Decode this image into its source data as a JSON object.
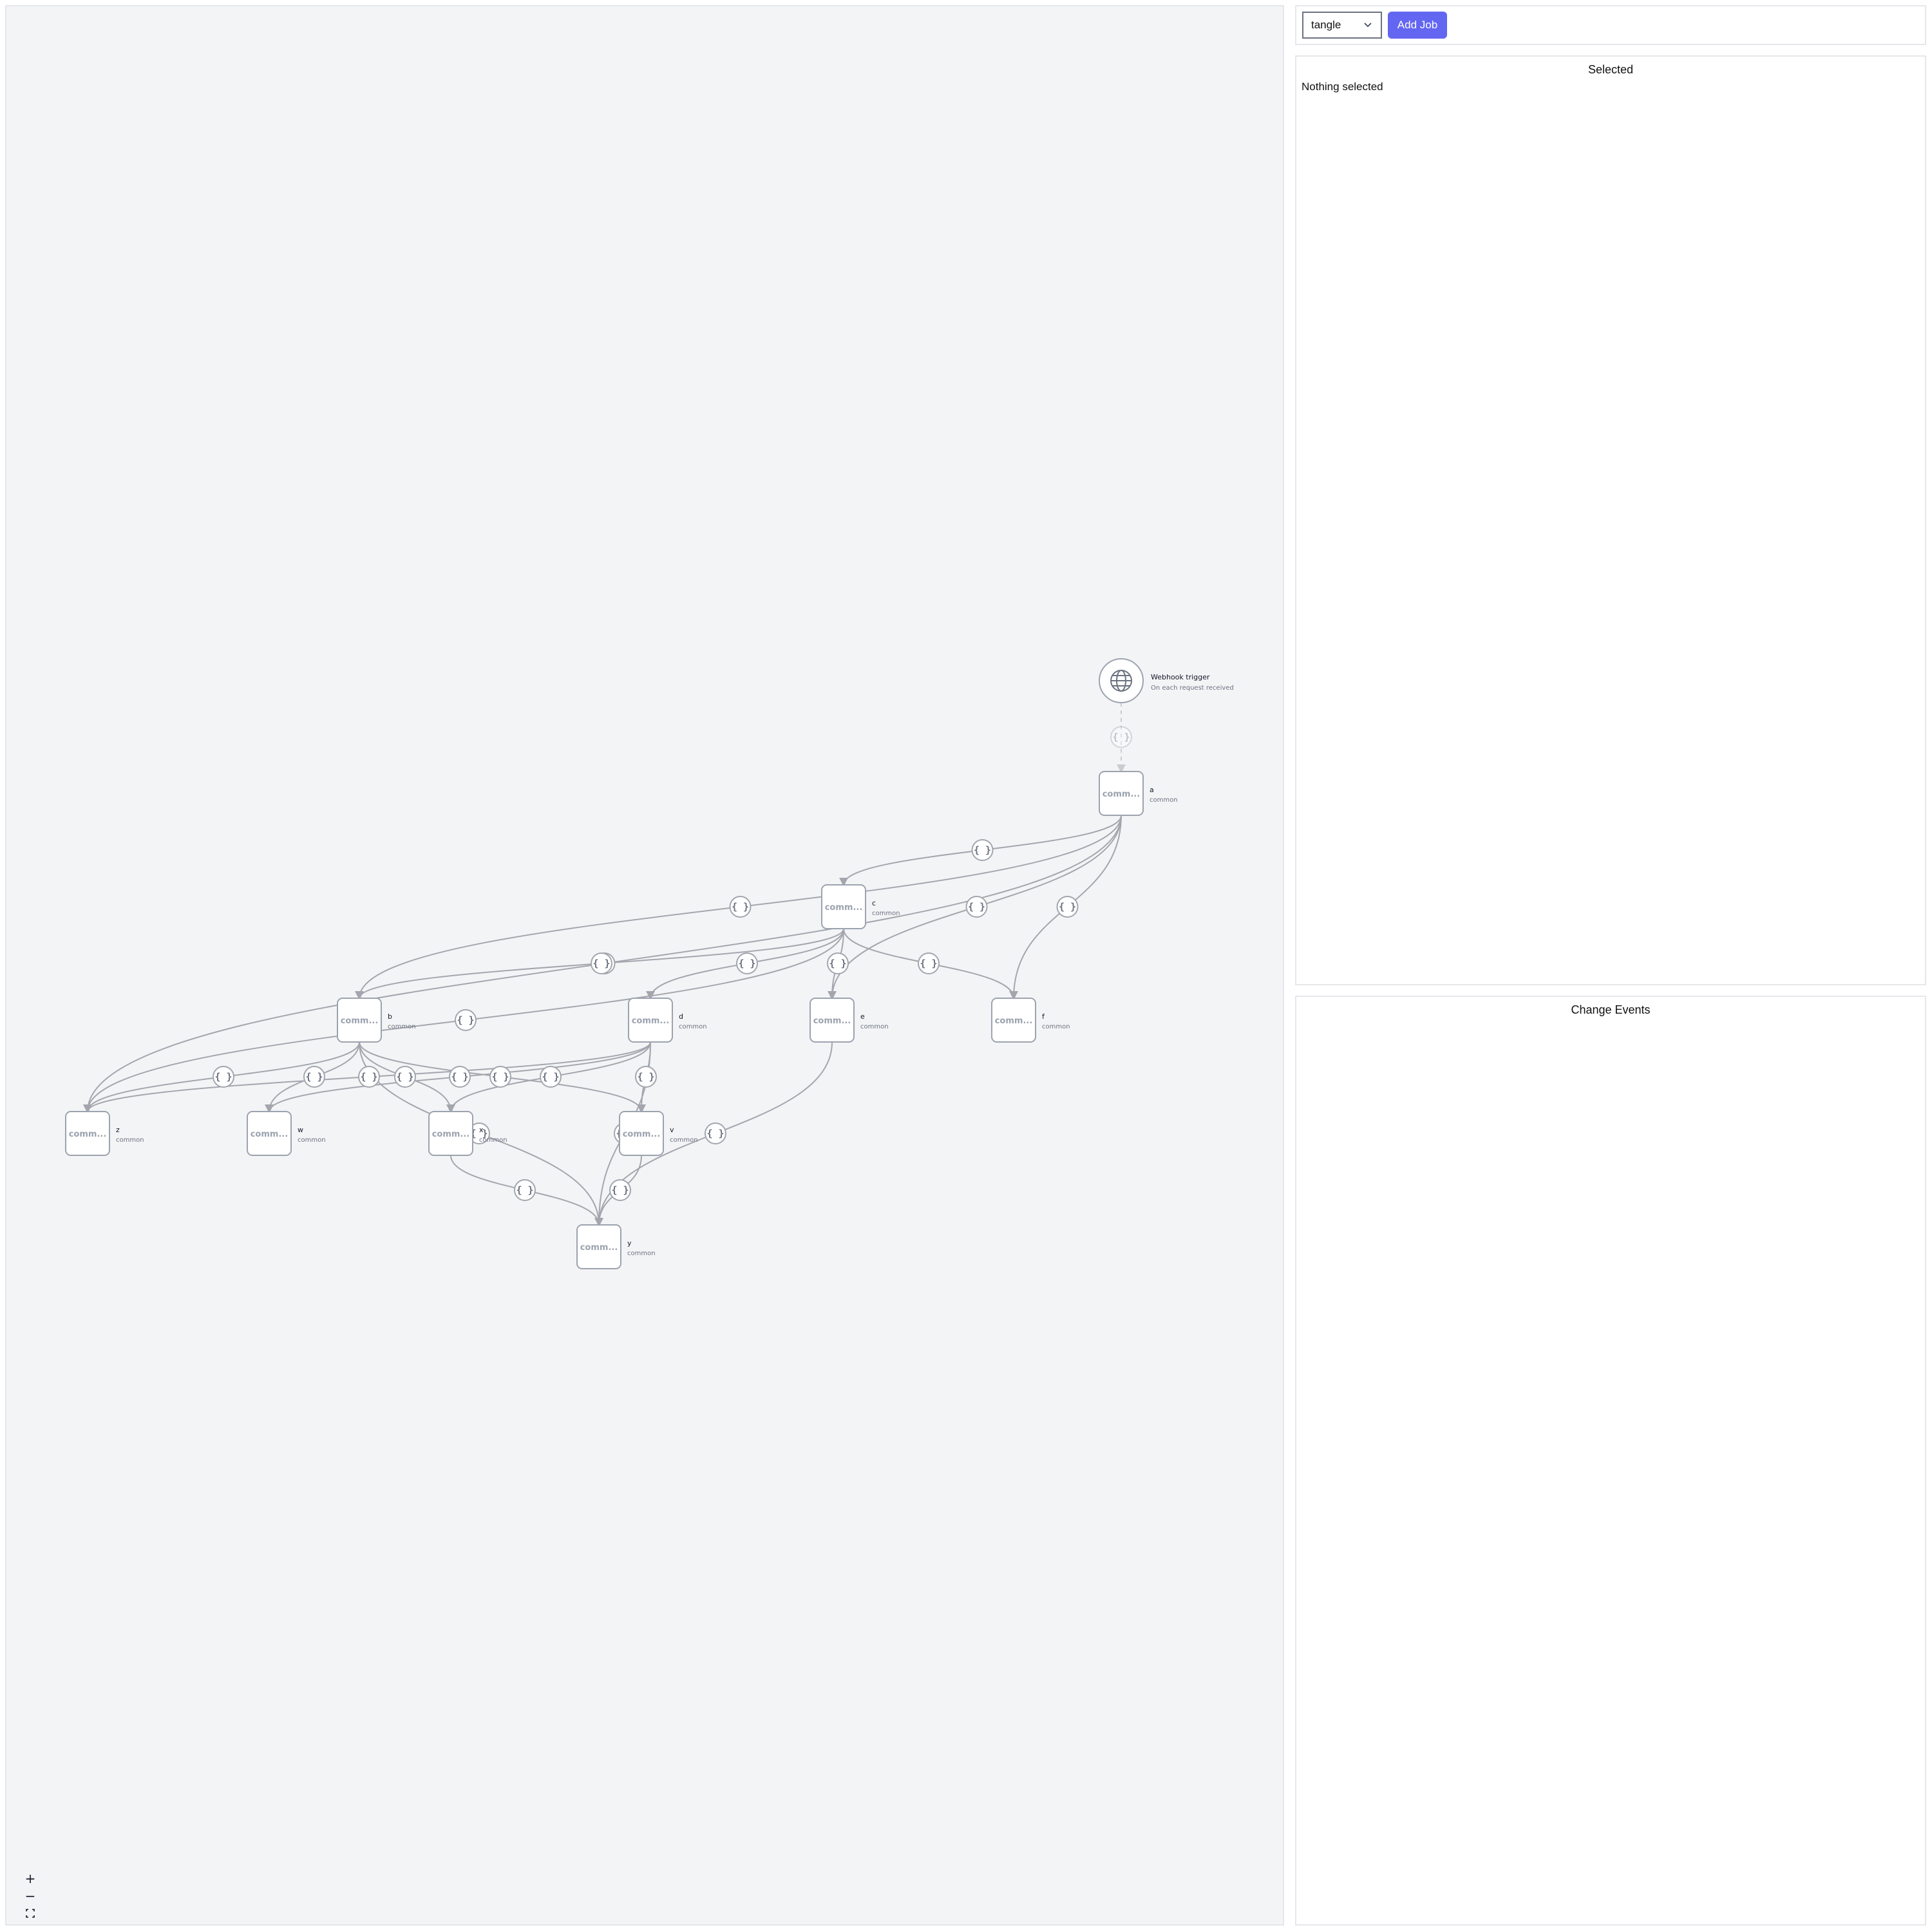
{
  "toolbar": {
    "workflow_select_value": "tangle",
    "add_job_label": "Add Job"
  },
  "selected_panel": {
    "title": "Selected",
    "empty_text": "Nothing selected"
  },
  "events_panel": {
    "title": "Change Events"
  },
  "zoom_controls": {
    "zoom_in": "+",
    "zoom_out": "−"
  },
  "graph": {
    "trigger": {
      "name": "Webhook trigger",
      "subtitle": "On each request received",
      "icon": "globe-icon"
    },
    "jobs": [
      {
        "id": "a",
        "name": "a",
        "subtitle": "common",
        "inner": "comm..."
      },
      {
        "id": "c",
        "name": "c",
        "subtitle": "common",
        "inner": "comm..."
      },
      {
        "id": "b",
        "name": "b",
        "subtitle": "common",
        "inner": "comm..."
      },
      {
        "id": "d",
        "name": "d",
        "subtitle": "common",
        "inner": "comm..."
      },
      {
        "id": "e",
        "name": "e",
        "subtitle": "common",
        "inner": "comm..."
      },
      {
        "id": "f",
        "name": "f",
        "subtitle": "common",
        "inner": "comm..."
      },
      {
        "id": "z",
        "name": "z",
        "subtitle": "common",
        "inner": "comm..."
      },
      {
        "id": "w",
        "name": "w",
        "subtitle": "common",
        "inner": "comm..."
      },
      {
        "id": "x",
        "name": "x",
        "subtitle": "common",
        "inner": "comm..."
      },
      {
        "id": "v",
        "name": "v",
        "subtitle": "common",
        "inner": "comm..."
      },
      {
        "id": "y",
        "name": "y",
        "subtitle": "common",
        "inner": "comm..."
      }
    ],
    "edge_label": "{ }",
    "edges": [
      [
        "trigger",
        "a"
      ],
      [
        "a",
        "c"
      ],
      [
        "a",
        "b"
      ],
      [
        "a",
        "z"
      ],
      [
        "a",
        "e"
      ],
      [
        "a",
        "f"
      ],
      [
        "c",
        "b"
      ],
      [
        "c",
        "d"
      ],
      [
        "c",
        "e"
      ],
      [
        "c",
        "f"
      ],
      [
        "c",
        "z"
      ],
      [
        "b",
        "z"
      ],
      [
        "b",
        "w"
      ],
      [
        "b",
        "x"
      ],
      [
        "b",
        "v"
      ],
      [
        "b",
        "y"
      ],
      [
        "d",
        "z"
      ],
      [
        "d",
        "w"
      ],
      [
        "d",
        "x"
      ],
      [
        "d",
        "v"
      ],
      [
        "d",
        "y"
      ],
      [
        "e",
        "y"
      ],
      [
        "x",
        "y"
      ],
      [
        "v",
        "y"
      ]
    ]
  }
}
